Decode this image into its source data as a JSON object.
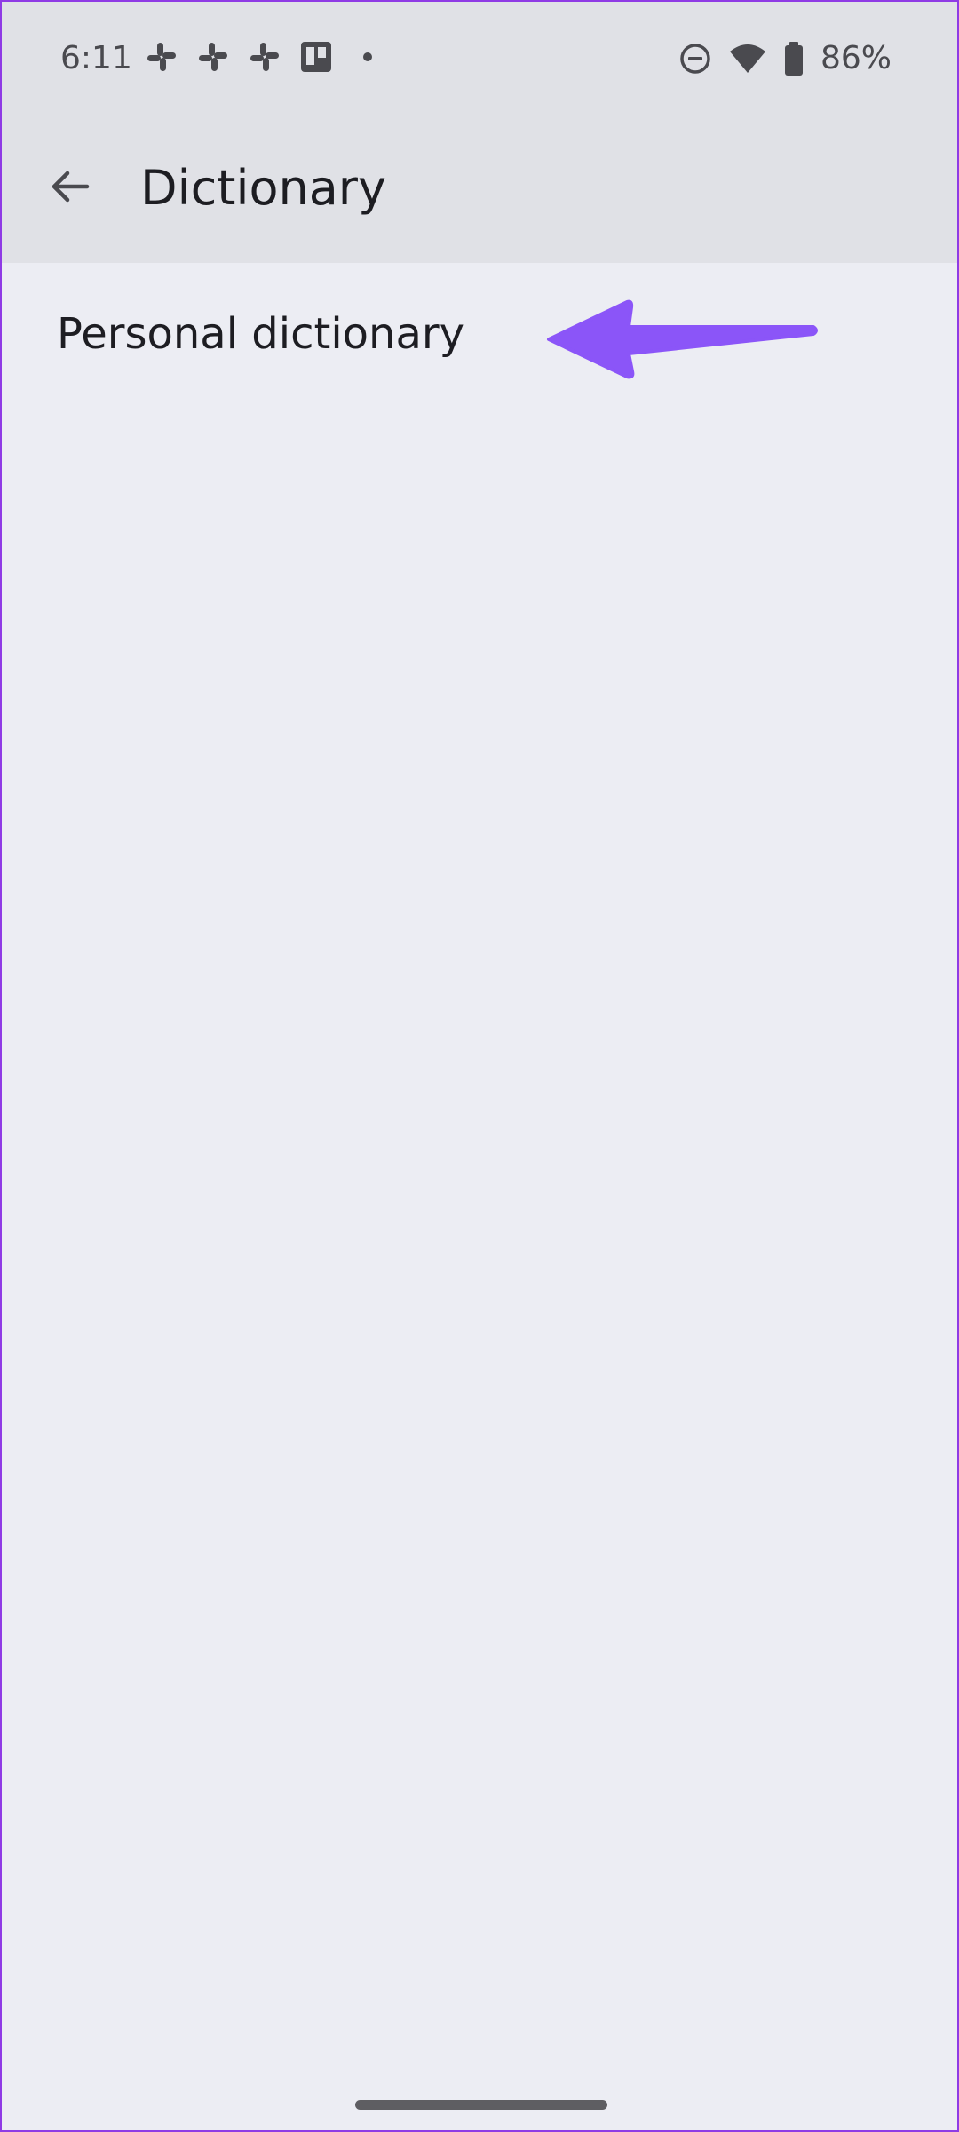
{
  "status_bar": {
    "time": "6:11",
    "notification_icons": [
      "slack-icon",
      "slack-icon",
      "slack-icon",
      "trello-icon",
      "more-dot-icon"
    ],
    "right_icons": [
      "do-not-disturb-icon",
      "wifi-icon",
      "battery-icon"
    ],
    "battery_percent": "86%"
  },
  "app_bar": {
    "back_icon": "arrow-back-icon",
    "title": "Dictionary"
  },
  "list": {
    "items": [
      {
        "label": "Personal dictionary"
      }
    ]
  },
  "annotation": {
    "type": "arrow-left",
    "color": "#8b55f8"
  },
  "colors": {
    "header_bg": "#e0e1e6",
    "page_bg": "#ecedf3",
    "text_primary": "#1d1d22",
    "icon_gray": "#4a4a4f"
  }
}
